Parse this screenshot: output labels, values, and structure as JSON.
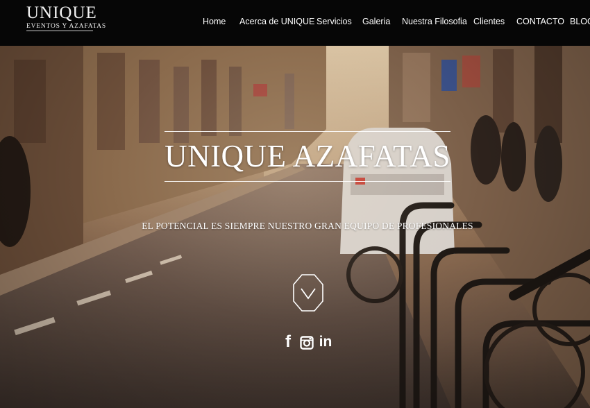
{
  "logo": {
    "main": "UNIQUE",
    "sub": "EVENTOS Y AZAFATAS"
  },
  "nav": {
    "items": [
      {
        "label": "Home"
      },
      {
        "label": "Acerca de UNIQUE"
      },
      {
        "label": "Servicios"
      },
      {
        "label": "Galeria"
      },
      {
        "label": "Nuestra Filosofia"
      },
      {
        "label": "Clientes"
      },
      {
        "label": "CONTACTO"
      },
      {
        "label": "BLOG"
      }
    ]
  },
  "hero": {
    "title": "UNIQUE AZAFATAS",
    "tagline": "EL POTENCIAL ES SIEMPRE NUESTRO GRAN EQUIPO DE PROFESIONALES",
    "scroll_icon": "chevron-down-octagon-icon"
  },
  "social": [
    {
      "icon": "facebook-icon",
      "glyph": "f"
    },
    {
      "icon": "instagram-icon",
      "glyph": ""
    },
    {
      "icon": "linkedin-icon",
      "glyph": "in"
    }
  ],
  "colors": {
    "topbar": "#060606",
    "text": "#ffffff",
    "hero_tone": "#a88868"
  }
}
